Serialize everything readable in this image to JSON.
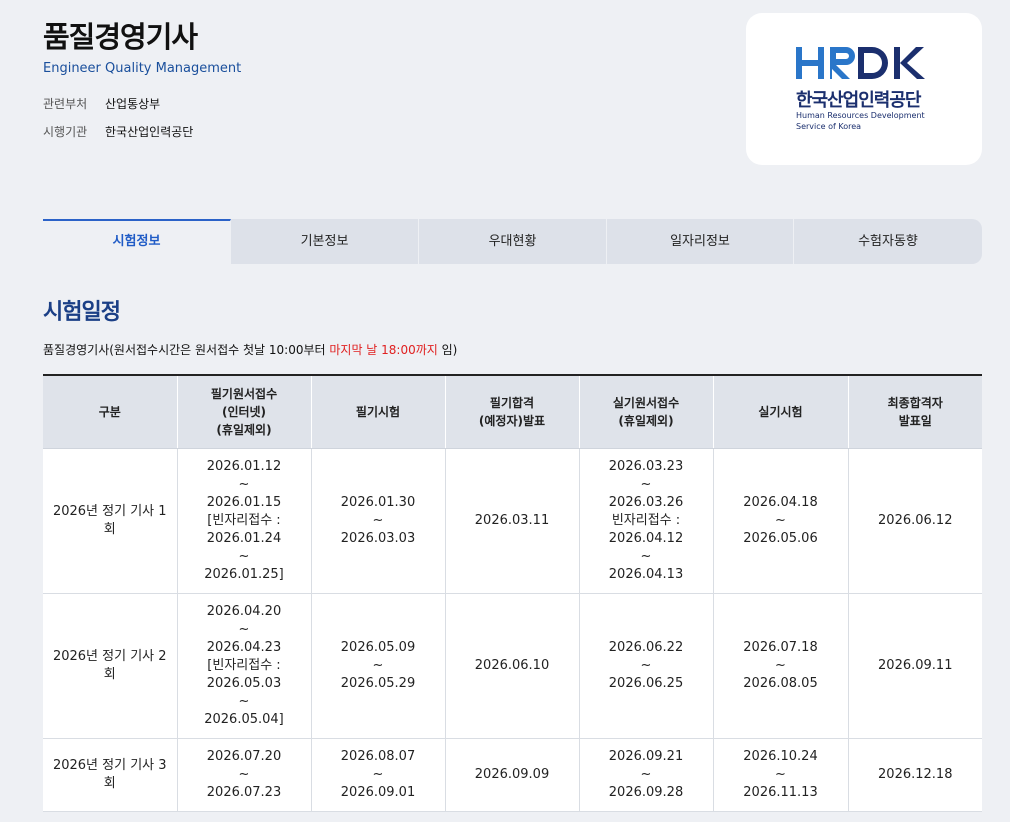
{
  "header": {
    "title": "품질경영기사",
    "subtitle": "Engineer Quality Management",
    "meta": [
      {
        "label": "관련부처",
        "value": "산업통상부"
      },
      {
        "label": "시행기관",
        "value": "한국산업인력공단"
      }
    ]
  },
  "logo": {
    "mark": "HRDK",
    "korean": "한국산업인력공단",
    "english_line1": "Human Resources Development",
    "english_line2": "Service of Korea",
    "colors": {
      "blue": "#2a76c9",
      "navy": "#1b2f6e"
    }
  },
  "tabs": [
    {
      "label": "시험정보",
      "active": true
    },
    {
      "label": "기본정보",
      "active": false
    },
    {
      "label": "우대현황",
      "active": false
    },
    {
      "label": "일자리정보",
      "active": false
    },
    {
      "label": "수험자동향",
      "active": false
    }
  ],
  "section": {
    "title": "시험일정",
    "note_prefix": "품질경영기사(원서접수시간은 원서접수 첫날 10:00부터 ",
    "note_highlight": "마지막 날 18:00까지",
    "note_suffix": " 임)"
  },
  "table": {
    "headers": [
      [
        "구분"
      ],
      [
        "필기원서접수",
        "(인터넷)",
        "(휴일제외)"
      ],
      [
        "필기시험"
      ],
      [
        "필기합격",
        "(예정자)발표"
      ],
      [
        "실기원서접수",
        "(휴일제외)"
      ],
      [
        "실기시험"
      ],
      [
        "최종합격자",
        "발표일"
      ]
    ],
    "rows": [
      {
        "cells": [
          [
            "2026년 정기 기사 1",
            "회"
          ],
          [
            "2026.01.12",
            "~",
            "2026.01.15",
            "[빈자리접수 :",
            "2026.01.24",
            "~",
            "2026.01.25]"
          ],
          [
            "2026.01.30",
            "~",
            "2026.03.03"
          ],
          [
            "2026.03.11"
          ],
          [
            "2026.03.23",
            "~",
            "2026.03.26",
            "빈자리접수 :",
            "2026.04.12",
            "~",
            "2026.04.13"
          ],
          [
            "2026.04.18",
            "~",
            "2026.05.06"
          ],
          [
            "2026.06.12"
          ]
        ]
      },
      {
        "cells": [
          [
            "2026년 정기 기사 2",
            "회"
          ],
          [
            "2026.04.20",
            "~",
            "2026.04.23",
            "[빈자리접수 :",
            "2026.05.03",
            "~",
            "2026.05.04]"
          ],
          [
            "2026.05.09",
            "~",
            "2026.05.29"
          ],
          [
            "2026.06.10"
          ],
          [
            "2026.06.22",
            "~",
            "2026.06.25"
          ],
          [
            "2026.07.18",
            "~",
            "2026.08.05"
          ],
          [
            "2026.09.11"
          ]
        ]
      },
      {
        "cells": [
          [
            "2026년 정기 기사 3",
            "회"
          ],
          [
            "2026.07.20",
            "~",
            "2026.07.23"
          ],
          [
            "2026.08.07",
            "~",
            "2026.09.01"
          ],
          [
            "2026.09.09"
          ],
          [
            "2026.09.21",
            "~",
            "2026.09.28"
          ],
          [
            "2026.10.24",
            "~",
            "2026.11.13"
          ],
          [
            "2026.12.18"
          ]
        ]
      }
    ]
  }
}
